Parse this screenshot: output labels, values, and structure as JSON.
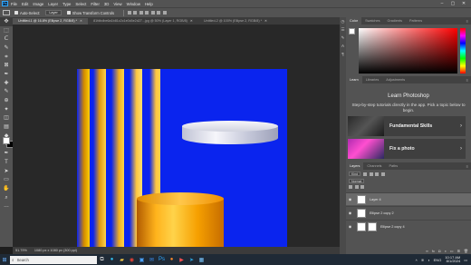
{
  "app": {
    "logo": "Ps"
  },
  "menu": [
    "File",
    "Edit",
    "Image",
    "Layer",
    "Type",
    "Select",
    "Filter",
    "3D",
    "View",
    "Window",
    "Help"
  ],
  "options_bar": {
    "auto_select_label": "Auto-Select:",
    "auto_select_value": "Layer",
    "transform_label": "Show Transform Controls"
  },
  "tabs": [
    {
      "label": "Untitled-1 @ 16.8% (Ellipse 2, RGB/8) *",
      "active": true
    },
    {
      "label": "81fdbdbe6a1b81c2c1e0c5e2d27...jpg @ 50% (Layer 1, RGB/8)",
      "active": false
    },
    {
      "label": "Untitled-2 @ 100% (Ellipse 2, RGB/8) *",
      "active": false
    }
  ],
  "toolbar": {
    "icons": [
      "move-icon",
      "marquee-icon",
      "lasso-icon",
      "quick-select-icon",
      "crop-icon",
      "frame-icon",
      "eyedropper-icon",
      "healing-icon",
      "brush-icon",
      "stamp-icon",
      "history-brush-icon",
      "eraser-icon",
      "gradient-icon",
      "blur-icon",
      "dodge-icon",
      "pen-icon",
      "type-icon",
      "path-select-icon",
      "rectangle-icon",
      "hand-icon",
      "zoom-icon",
      "more-icon"
    ],
    "glyphs": [
      "✥",
      "⬚",
      "ᑕ",
      "✎",
      "⌗",
      "⊠",
      "✒",
      "✚",
      "✎",
      "⊕",
      "✦",
      "◫",
      "▤",
      "◆",
      "◐",
      "✒",
      "T",
      "➤",
      "▭",
      "✋",
      "⌕",
      "…"
    ],
    "foreground": "#ffffff",
    "background": "#000000"
  },
  "canvas": {
    "background": "#0a24ee"
  },
  "status": {
    "zoom": "51.79%",
    "dimensions": "1080 px x 1080 px (300 ppi)"
  },
  "panels": {
    "color_tabs": [
      "Color",
      "Swatches",
      "Gradients",
      "Patterns"
    ],
    "learn_tabs": [
      "Learn",
      "Libraries",
      "Adjustments"
    ],
    "learn": {
      "title": "Learn Photoshop",
      "description": "Step-by-step tutorials directly in the app. Pick a topic below to begin.",
      "cards": [
        "Fundamental Skills",
        "Fix a photo"
      ]
    },
    "layers_tabs": [
      "Layers",
      "Channels",
      "Paths"
    ],
    "layers_kind": "Kind",
    "layers_blend": "Normal",
    "layers": [
      {
        "name": "Layer 4",
        "selected": true
      },
      {
        "name": "Ellipse 2 copy 2",
        "selected": false
      },
      {
        "name": "Ellipse 2 copy 4",
        "selected": false
      }
    ]
  },
  "taskbar": {
    "search_placeholder": "Search",
    "time": "10:17 AM",
    "date": "8/1/2024",
    "lang": "ENG"
  }
}
